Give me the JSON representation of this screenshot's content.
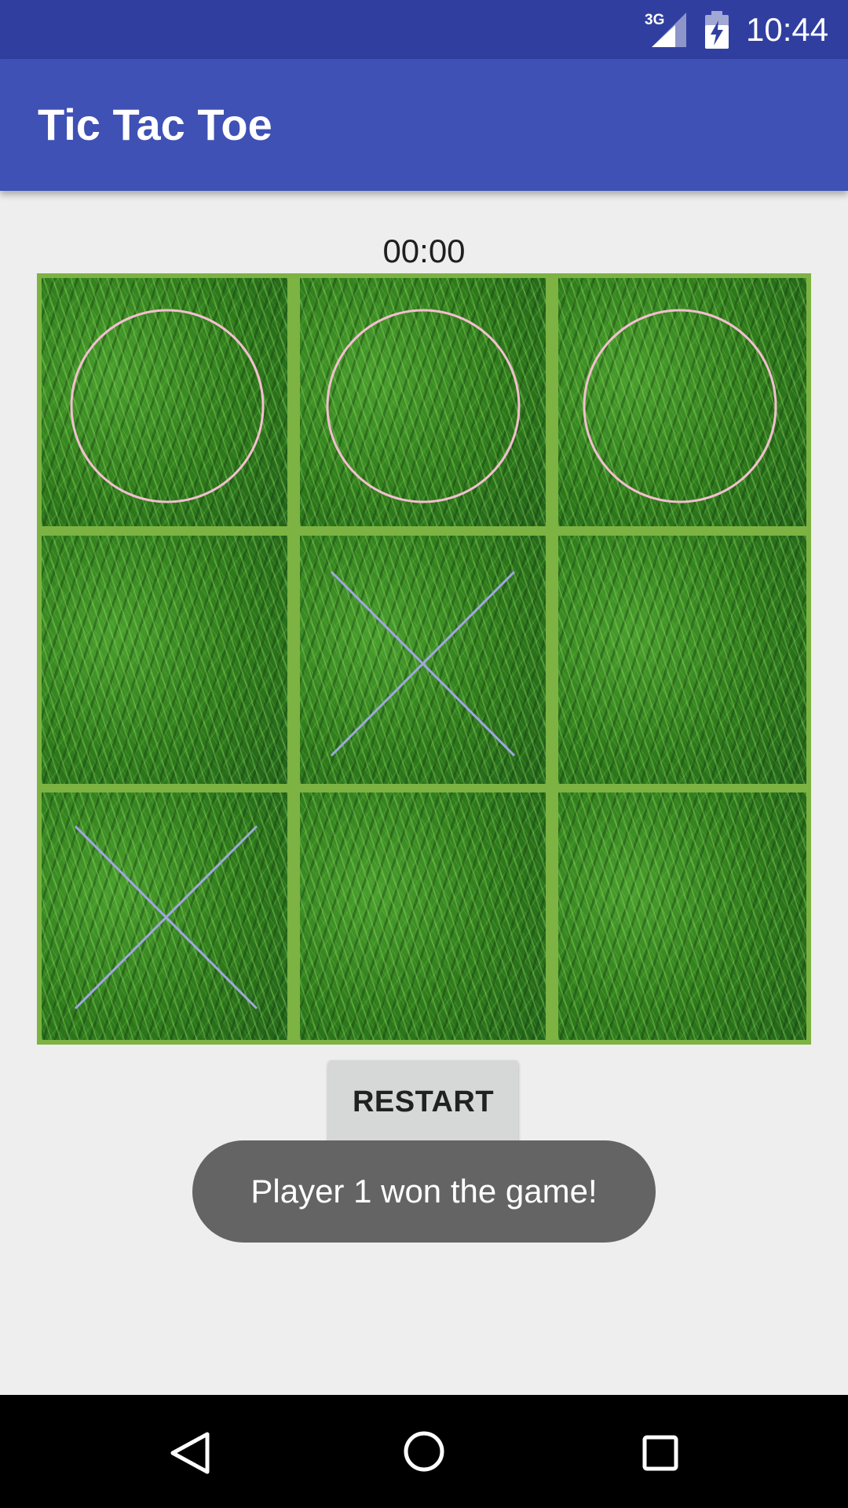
{
  "status_bar": {
    "network_label": "3G",
    "network_icon": "signal-icon",
    "battery_icon": "battery-charging-icon",
    "time": "10:44",
    "background": "#303f9f"
  },
  "app_bar": {
    "title": "Tic Tac Toe",
    "background": "#3f51b5"
  },
  "timer": "00:00",
  "board": {
    "line_color": "#7cb342",
    "o_color": "#f4bfd0",
    "x_color": "#9fa8e0",
    "cells": [
      "O",
      "O",
      "O",
      "",
      "X",
      "",
      "X",
      "",
      ""
    ]
  },
  "restart_label": "RESTART",
  "toast": "Player 1 won the game!",
  "nav_bar": {
    "back_icon": "back-triangle-icon",
    "home_icon": "home-circle-icon",
    "recents_icon": "recents-square-icon"
  }
}
